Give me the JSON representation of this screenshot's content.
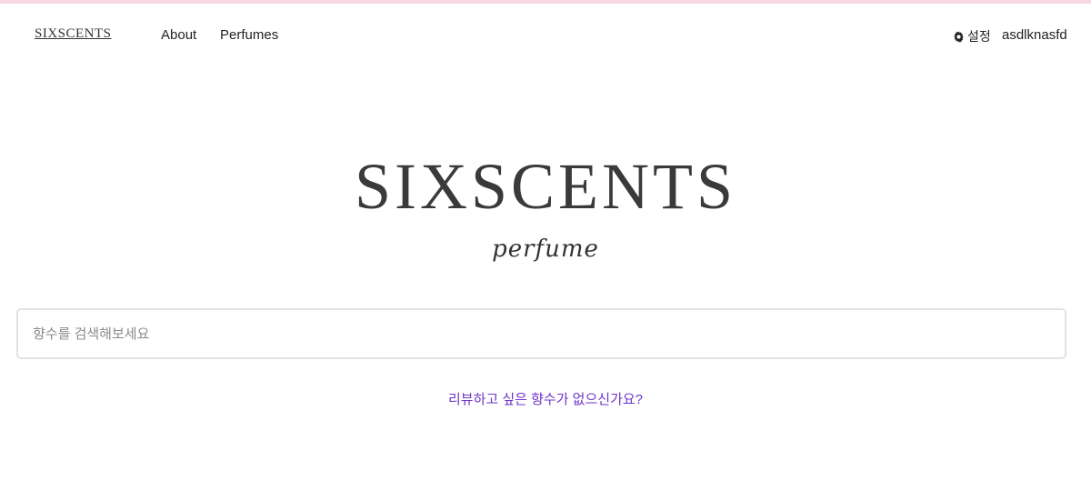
{
  "nav": {
    "brand": "SIXSCENTS",
    "links": [
      "About",
      "Perfumes"
    ],
    "settings_label": "설정",
    "settings_icon": "gear-icon",
    "username": "asdlknasfd"
  },
  "hero": {
    "title": "SIXSCENTS",
    "subtitle": "perfume"
  },
  "search": {
    "placeholder": "향수를 검색해보세요",
    "value": ""
  },
  "request_link": "리뷰하고 싶은 향수가 없으신가요?",
  "colors": {
    "top_border": "#f9d6e0",
    "link_accent": "#6f35c9",
    "title_text": "#3a3a3a"
  }
}
